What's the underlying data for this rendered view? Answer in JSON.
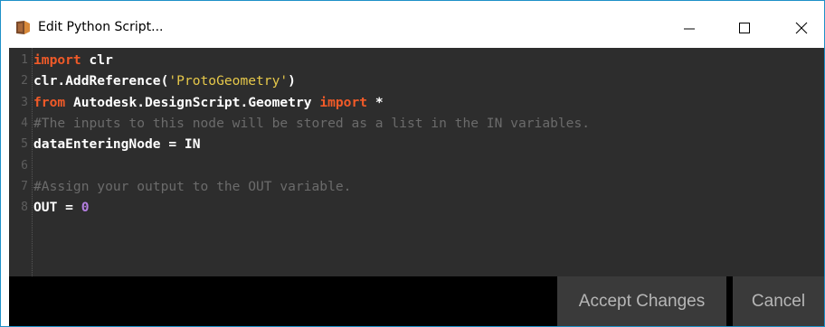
{
  "window": {
    "title": "Edit Python Script...",
    "controls": {
      "minimize": "—",
      "maximize": "☐",
      "close": "✕"
    }
  },
  "editor": {
    "lines": [
      {
        "number": "1",
        "tokens": [
          {
            "t": "import",
            "c": "kw"
          },
          {
            "t": " clr",
            "c": "plain"
          }
        ]
      },
      {
        "number": "2",
        "tokens": [
          {
            "t": "clr.AddReference(",
            "c": "plain"
          },
          {
            "t": "'ProtoGeometry'",
            "c": "str"
          },
          {
            "t": ")",
            "c": "plain"
          }
        ]
      },
      {
        "number": "3",
        "tokens": [
          {
            "t": "from",
            "c": "kw"
          },
          {
            "t": " Autodesk.DesignScript.Geometry ",
            "c": "plain"
          },
          {
            "t": "import",
            "c": "kw"
          },
          {
            "t": " *",
            "c": "plain"
          }
        ]
      },
      {
        "number": "4",
        "tokens": [
          {
            "t": "#The inputs to this node will be stored as a list in the IN variables.",
            "c": "cmt"
          }
        ]
      },
      {
        "number": "5",
        "tokens": [
          {
            "t": "dataEnteringNode = IN",
            "c": "plain"
          }
        ]
      },
      {
        "number": "6",
        "tokens": []
      },
      {
        "number": "7",
        "tokens": [
          {
            "t": "#Assign your output to the OUT variable.",
            "c": "cmt"
          }
        ]
      },
      {
        "number": "8",
        "tokens": [
          {
            "t": "OUT = ",
            "c": "plain"
          },
          {
            "t": "0",
            "c": "num"
          }
        ]
      }
    ]
  },
  "buttons": {
    "accept": "Accept Changes",
    "cancel": "Cancel"
  }
}
